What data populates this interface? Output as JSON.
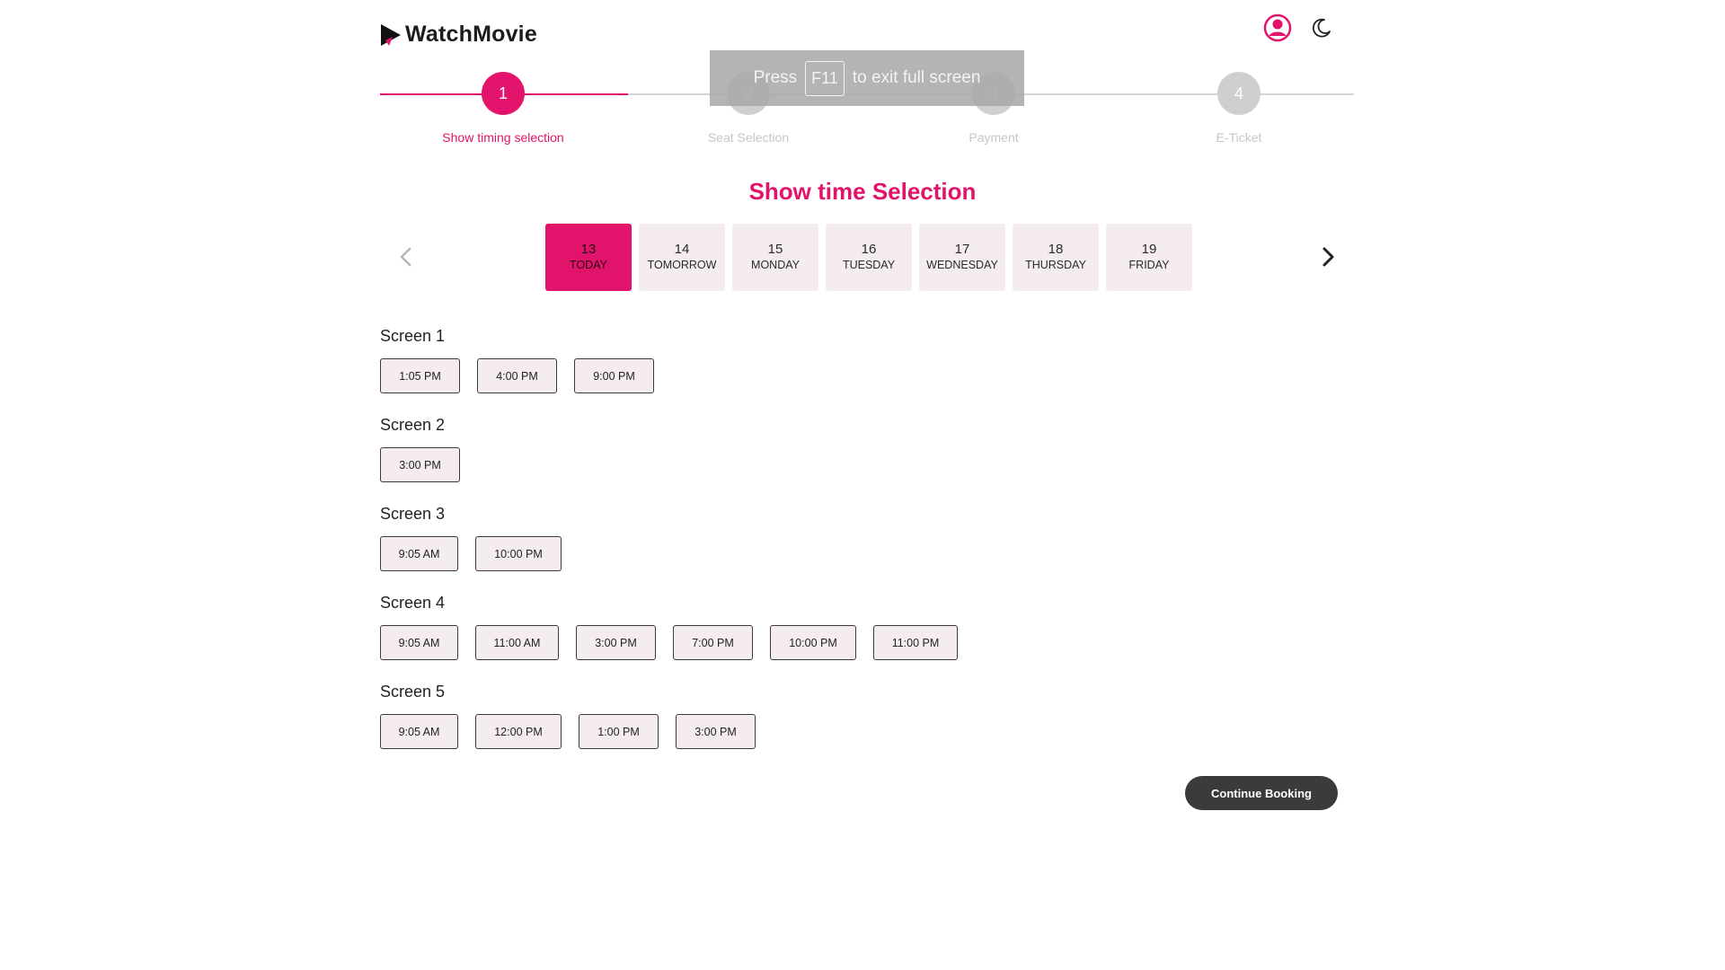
{
  "brand": {
    "name": "WatchMovie",
    "logo_icon": "play-triangle-logo",
    "accent": "#e1136b"
  },
  "header": {
    "user_icon": "user-circle-icon",
    "theme_icon": "moon-icon"
  },
  "stepper": {
    "steps": [
      {
        "number": "1",
        "label": "Show timing selection",
        "state": "active"
      },
      {
        "number": "2",
        "label": "Seat Selection",
        "state": "inactive"
      },
      {
        "number": "3",
        "label": "Payment",
        "state": "inactive"
      },
      {
        "number": "4",
        "label": "E-Ticket",
        "state": "inactive"
      }
    ]
  },
  "fullscreen_toast": {
    "before": "Press",
    "key": "F11",
    "after": "to exit full screen"
  },
  "title": "Show time Selection",
  "dates": [
    {
      "num": "13",
      "day": "TODAY",
      "selected": true
    },
    {
      "num": "14",
      "day": "TOMORROW",
      "selected": false
    },
    {
      "num": "15",
      "day": "MONDAY",
      "selected": false
    },
    {
      "num": "16",
      "day": "TUESDAY",
      "selected": false
    },
    {
      "num": "17",
      "day": "WEDNESDAY",
      "selected": false
    },
    {
      "num": "18",
      "day": "THURSDAY",
      "selected": false
    },
    {
      "num": "19",
      "day": "FRIDAY",
      "selected": false
    }
  ],
  "screens": [
    {
      "name": "Screen 1",
      "times": [
        "1:05 PM",
        "4:00 PM",
        "9:00 PM"
      ]
    },
    {
      "name": "Screen 2",
      "times": [
        "3:00 PM"
      ]
    },
    {
      "name": "Screen 3",
      "times": [
        "9:05 AM",
        "10:00 PM"
      ]
    },
    {
      "name": "Screen 4",
      "times": [
        "9:05 AM",
        "11:00 AM",
        "3:00 PM",
        "7:00 PM",
        "10:00 PM",
        "11:00 PM"
      ]
    },
    {
      "name": "Screen 5",
      "times": [
        "9:05 AM",
        "12:00 PM",
        "1:00 PM",
        "3:00 PM"
      ]
    }
  ],
  "continue_label": "Continue Booking"
}
